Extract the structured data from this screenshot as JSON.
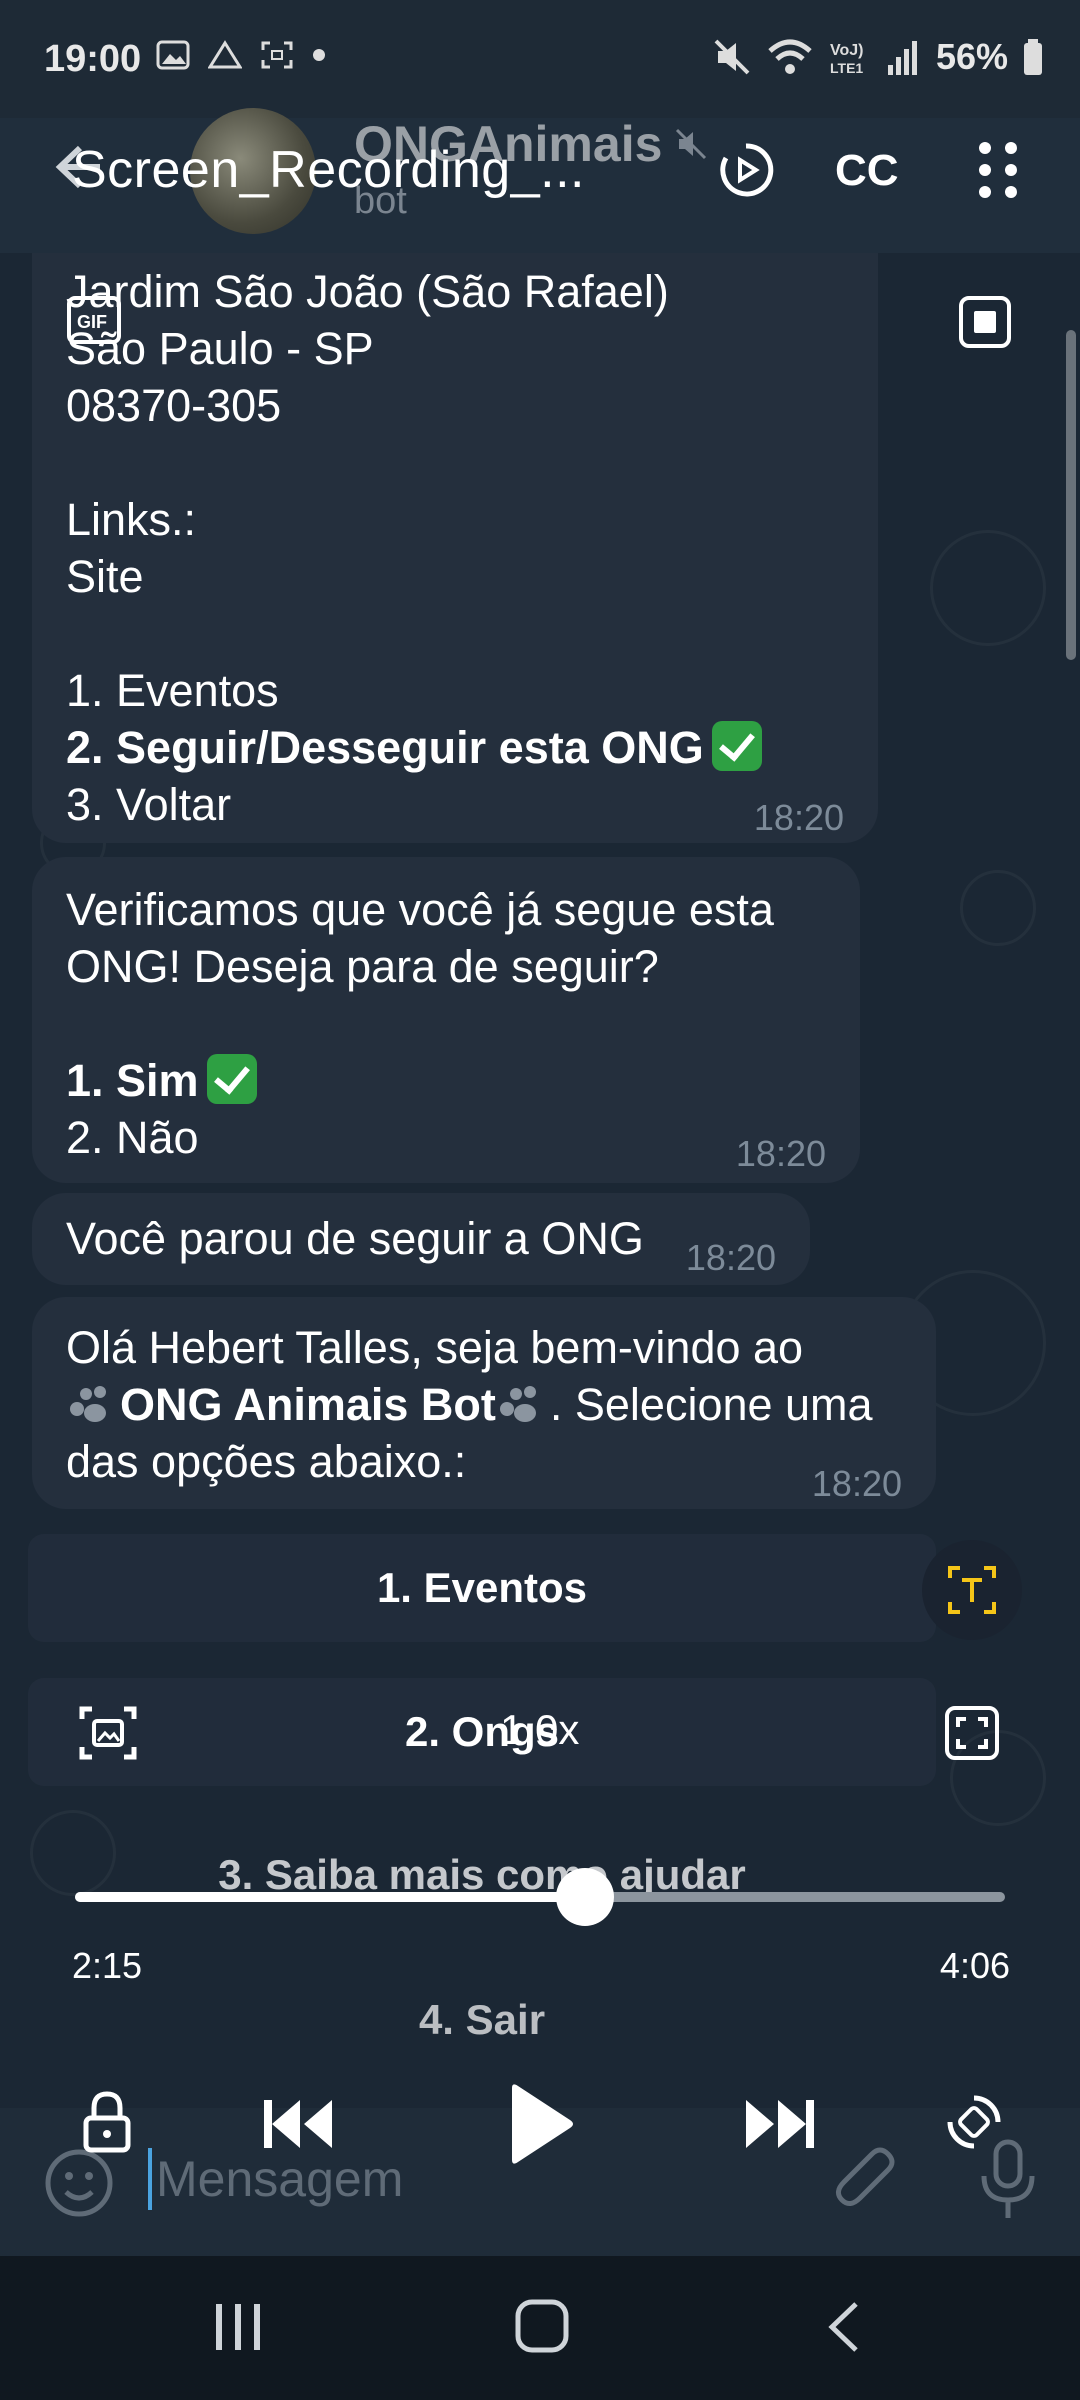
{
  "status_bar": {
    "time": "19:00",
    "battery": "56%",
    "left_icons": [
      "gallery-icon",
      "drive-icon",
      "screenshot-icon",
      "dot-icon"
    ],
    "right_icons": [
      "mute-icon",
      "wifi-icon",
      "volte-icon",
      "signal-icon",
      "battery-icon"
    ]
  },
  "header": {
    "chat_name": "ONGAnimais",
    "chat_subtitle": "bot",
    "recording_title": "Screen_Recording_...",
    "cc_label": "CC"
  },
  "messages": [
    {
      "lines": [
        {
          "text": "Jardim São João (São Rafael)",
          "bold": false
        },
        {
          "text": "São Paulo - SP",
          "bold": false
        },
        {
          "text": "08370-305",
          "bold": false
        },
        {
          "text": "",
          "bold": false
        },
        {
          "text": "Links.:",
          "bold": false
        },
        {
          "text": "Site",
          "bold": false
        },
        {
          "text": "",
          "bold": false
        },
        {
          "text": "1. Eventos",
          "bold": false
        },
        {
          "text": "2. Seguir/Desseguir esta ONG",
          "bold": true,
          "check": true
        },
        {
          "text": "3. Voltar",
          "bold": false
        }
      ],
      "time": "18:20"
    },
    {
      "lines": [
        {
          "text": "Verificamos que você já segue esta",
          "bold": false
        },
        {
          "text": "ONG! Deseja para de seguir?",
          "bold": false
        },
        {
          "text": "",
          "bold": false
        },
        {
          "text": "1. Sim",
          "bold": true,
          "check": true
        },
        {
          "text": "2. Não",
          "bold": false
        }
      ],
      "time": "18:20"
    },
    {
      "lines": [
        {
          "text": "Você parou de seguir a ONG",
          "bold": false
        }
      ],
      "time": "18:20"
    },
    {
      "line1": "Olá Hebert Talles, seja bem-vindo ao",
      "line2_bold": "ONG Animais Bot",
      "line2_rest": ". Selecione uma",
      "line3": "das opções abaixo.:",
      "time": "18:20"
    }
  ],
  "keyboard_buttons": [
    "1. Eventos",
    "2. Ongs",
    "3. Saiba mais como ajudar",
    "4. Sair"
  ],
  "player": {
    "speed": "1.0x",
    "current_time": "2:15",
    "total_time": "4:06",
    "progress": 0.548
  },
  "composer": {
    "placeholder": "Mensagem"
  },
  "icons": {
    "gif": "gif-icon",
    "stop": "stop-icon",
    "text_recognition": "text-recognition-icon",
    "capture": "capture-icon",
    "fullscreen": "fullscreen-icon",
    "lock": "lock-icon",
    "previous": "skip-previous-icon",
    "play": "play-icon",
    "next": "skip-next-icon",
    "rotate": "rotate-icon"
  },
  "colors": {
    "background": "#17212b",
    "bubble": "#242f3d",
    "check_green": "#2ea043",
    "text_button_accent": "#f5c518"
  }
}
